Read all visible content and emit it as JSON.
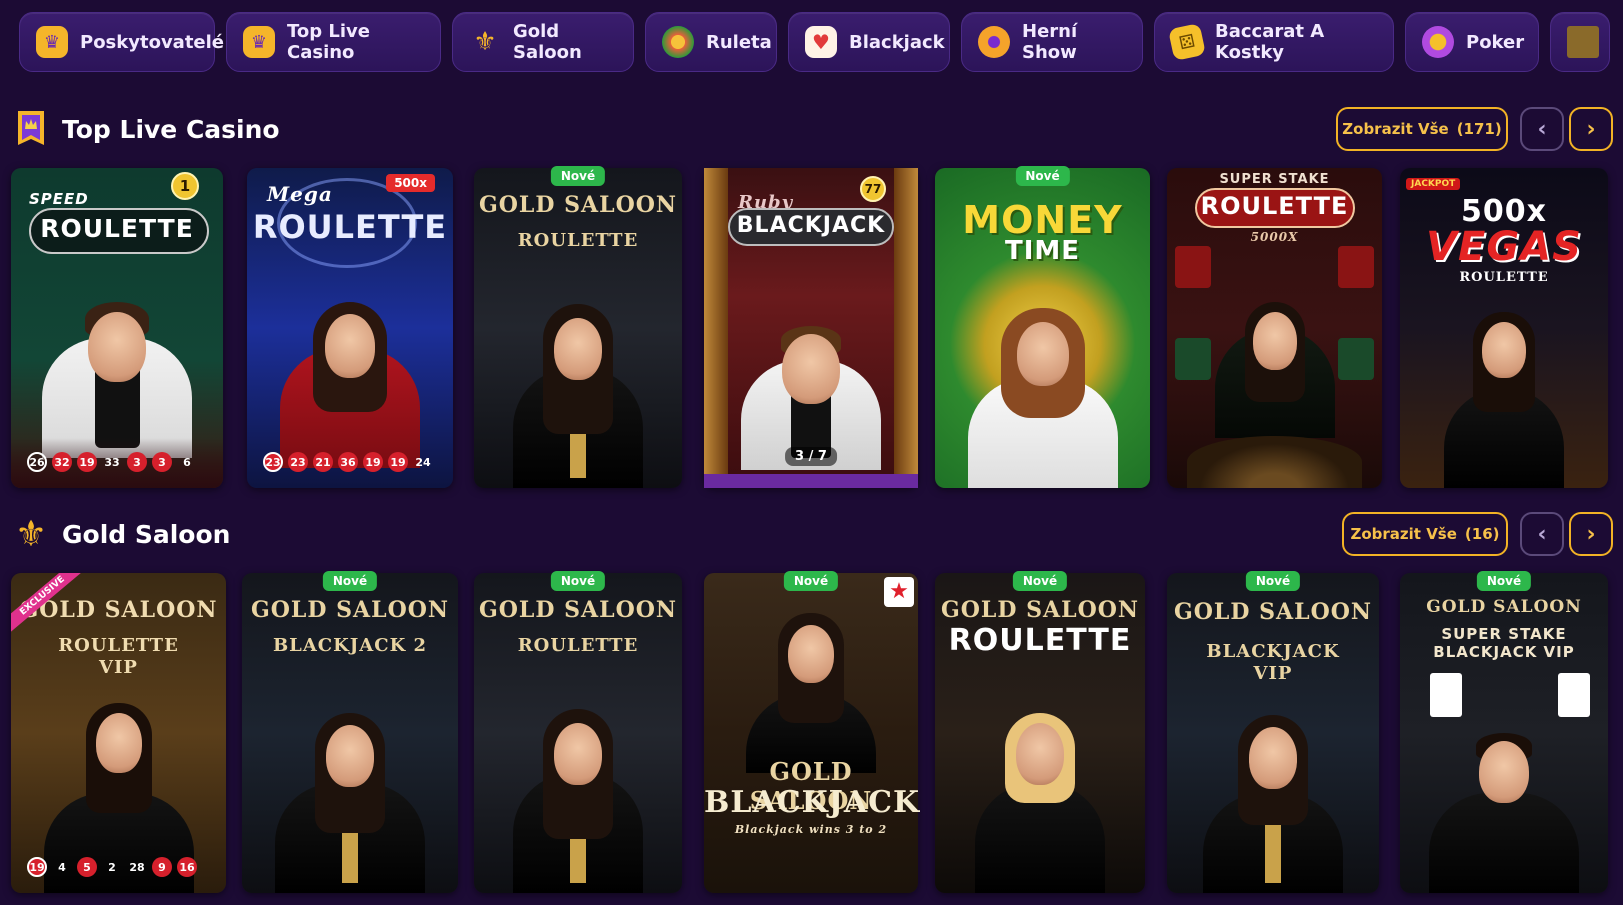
{
  "categories": [
    {
      "label": "Poskytovatelé",
      "icon": "provider-icon",
      "color": "#f5b52a"
    },
    {
      "label": "Top Live Casino",
      "icon": "crown-banner-icon",
      "color": "#f5b52a"
    },
    {
      "label": "Gold Saloon",
      "icon": "fleur-de-lis-icon",
      "color": "#f5b52a"
    },
    {
      "label": "Ruleta",
      "icon": "roulette-icon",
      "color": "#e9603a"
    },
    {
      "label": "Blackjack",
      "icon": "cards-icon",
      "color": "#e23a3a"
    },
    {
      "label": "Herní Show",
      "icon": "wheel-icon",
      "color": "#f5a32a"
    },
    {
      "label": "Baccarat A Kostky",
      "icon": "dice-icon",
      "color": "#f5c02a"
    },
    {
      "label": "Poker",
      "icon": "poker-chip-icon",
      "color": "#b04ae0"
    }
  ],
  "sections": [
    {
      "title": "Top Live Casino",
      "icon": "crown-banner-icon",
      "show_all_label": "Zobrazit Vše",
      "show_all_count": "(171)"
    },
    {
      "title": "Gold Saloon",
      "icon": "fleur-de-lis-icon",
      "show_all_label": "Zobrazit Vše",
      "show_all_count": "(16)"
    }
  ],
  "top_live_games": [
    {
      "line1": "SPEED",
      "line2": "ROULETTE",
      "badge": "1",
      "numbers": [
        "26",
        "32",
        "19",
        "33",
        "3",
        "3",
        "6"
      ]
    },
    {
      "line1": "Mega",
      "line2": "ROULETTE",
      "badge": "500x",
      "numbers": [
        "23",
        "23",
        "21",
        "36",
        "19",
        "19",
        "24"
      ]
    },
    {
      "line1": "GOLD SALOON",
      "line2": "ROULETTE",
      "badge": "Nové"
    },
    {
      "line1": "Ruby",
      "line2": "BLACKJACK",
      "badge": "77",
      "seats": "3 / 7"
    },
    {
      "line1": "MONEY",
      "line2": "TIME",
      "badge": "Nové"
    },
    {
      "line1": "SUPER STAKE",
      "line2": "ROULETTE",
      "sub": "5000X"
    },
    {
      "line1": "500x",
      "line2": "VEGAS",
      "sub": "ROULETTE",
      "corner": "JACKPOT"
    }
  ],
  "gold_saloon_games": [
    {
      "line1": "GOLD SALOON",
      "line2": "ROULETTE",
      "line3": "VIP",
      "ribbon": "EXCLUSIVE",
      "numbers": [
        "19",
        "4",
        "5",
        "2",
        "28",
        "9",
        "16"
      ]
    },
    {
      "line1": "GOLD SALOON",
      "line2": "BLACKJACK 2",
      "badge": "Nové"
    },
    {
      "line1": "GOLD SALOON",
      "line2": "ROULETTE",
      "badge": "Nové"
    },
    {
      "line1": "GOLD SALOON",
      "line2": "BLACKJACK",
      "badge": "Nové",
      "sub": "Blackjack wins 3 to 2"
    },
    {
      "line1": "GOLD SALOON",
      "line2": "ROULETTE",
      "badge": "Nové"
    },
    {
      "line1": "GOLD SALOON",
      "line2": "BLACKJACK",
      "line3": "VIP",
      "badge": "Nové"
    },
    {
      "line1": "GOLD SALOON",
      "line2": "SUPER STAKE",
      "line3": "BLACKJACK VIP",
      "badge": "Nové"
    }
  ],
  "nav": {
    "prev": "‹",
    "next": "›"
  }
}
